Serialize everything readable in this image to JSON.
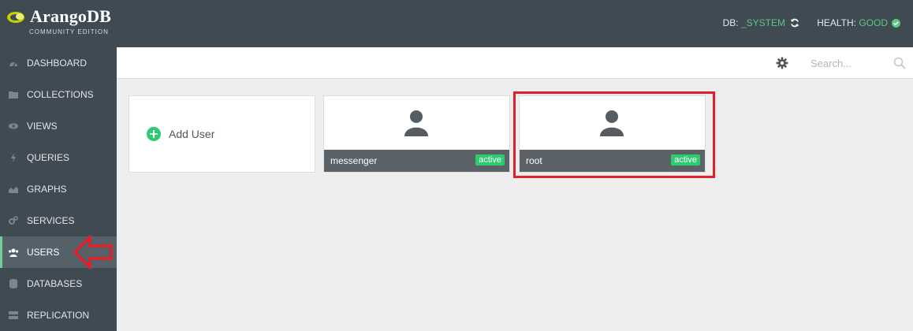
{
  "brand": {
    "name": "ArangoDB",
    "edition": "COMMUNITY EDITION"
  },
  "header": {
    "db_label": "DB:",
    "db_value": "_SYSTEM",
    "health_label": "HEALTH:",
    "health_value": "GOOD"
  },
  "sidebar": {
    "items": [
      {
        "label": "DASHBOARD",
        "icon": "dashboard-icon"
      },
      {
        "label": "COLLECTIONS",
        "icon": "folder-icon"
      },
      {
        "label": "VIEWS",
        "icon": "eye-icon"
      },
      {
        "label": "QUERIES",
        "icon": "bolt-icon"
      },
      {
        "label": "GRAPHS",
        "icon": "chart-icon"
      },
      {
        "label": "SERVICES",
        "icon": "gears-icon"
      },
      {
        "label": "USERS",
        "icon": "users-icon"
      },
      {
        "label": "DATABASES",
        "icon": "database-icon"
      },
      {
        "label": "REPLICATION",
        "icon": "server-icon"
      }
    ],
    "active": "USERS"
  },
  "toolbar": {
    "search_placeholder": "Search..."
  },
  "content": {
    "add_user_label": "Add User",
    "users": [
      {
        "name": "messenger",
        "status": "active"
      },
      {
        "name": "root",
        "status": "active"
      }
    ]
  },
  "colors": {
    "sidebar": "#404a53",
    "accent": "#5bc87f",
    "highlight": "#e0202a"
  }
}
